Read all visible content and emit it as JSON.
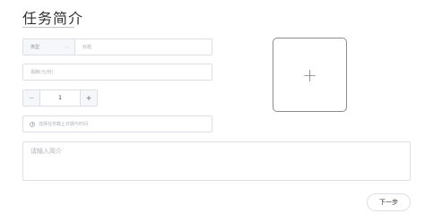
{
  "header": {
    "title": "任务简介"
  },
  "form": {
    "type_select": {
      "label": "类型",
      "icon": "chevron-down-icon"
    },
    "title_field": {
      "placeholder": "标题",
      "value": ""
    },
    "reward_field": {
      "placeholder": "报酬(元/份)",
      "value": ""
    },
    "quantity": {
      "value": "1",
      "minus_label": "−",
      "plus_label": "+"
    },
    "deadline": {
      "placeholder": "选择任务截止日期与时间",
      "icon": "clock-icon"
    },
    "intro": {
      "placeholder": "请输入简介",
      "value": ""
    }
  },
  "upload": {
    "icon": "plus-icon",
    "label": "+"
  },
  "footer": {
    "next_label": "下一步"
  }
}
